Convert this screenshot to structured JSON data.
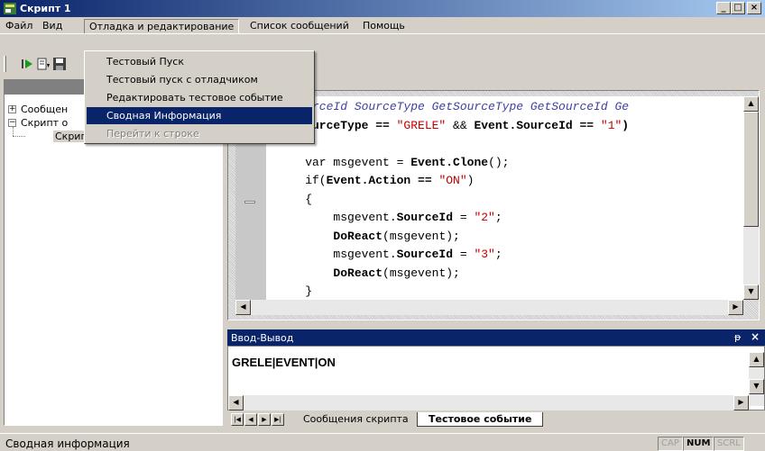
{
  "window": {
    "title": "Скрипт 1",
    "buttons": {
      "minimize": "_",
      "maximize": "□",
      "close": "×"
    }
  },
  "menubar": {
    "items": [
      "Файл",
      "Вид",
      "Отладка и редактирование",
      "Список сообщений",
      "Помощь"
    ],
    "open_index": 2
  },
  "debug_menu": {
    "items": [
      {
        "label": "Тестовый Пуск",
        "state": "normal"
      },
      {
        "label": "Тестовый пуск с отладчиком",
        "state": "normal"
      },
      {
        "label": "Редактировать тестовое событие",
        "state": "normal"
      },
      {
        "label": "Сводная Информация",
        "state": "highlighted"
      },
      {
        "label": "Перейти к строке",
        "state": "disabled"
      }
    ]
  },
  "tree": {
    "items": [
      {
        "label": "Сообщен",
        "expander": "+"
      },
      {
        "label": "Скрипт о",
        "expander": "−"
      },
      {
        "label": "Скрип",
        "expander": ""
      }
    ]
  },
  "editor": {
    "lines": [
      {
        "segments": [
          {
            "t": "n SourceId SourceType GetSourceType GetSourceId Ge",
            "c": "cmt"
          }
        ]
      },
      {
        "segments": [
          {
            "t": "nt.SourceType == ",
            "c": "kw"
          },
          {
            "t": "\"GRELE\"",
            "c": "str"
          },
          {
            "t": " && ",
            "c": ""
          },
          {
            "t": "Event.SourceId == ",
            "c": "kw"
          },
          {
            "t": "\"1\"",
            "c": "str"
          },
          {
            "t": ")",
            "c": "kw"
          }
        ]
      },
      {
        "segments": [
          {
            "t": "",
            "c": ""
          }
        ]
      },
      {
        "segments": [
          {
            "t": "    var msgevent = ",
            "c": ""
          },
          {
            "t": "Event.Clone",
            "c": "kw"
          },
          {
            "t": "();",
            "c": ""
          }
        ]
      },
      {
        "segments": [
          {
            "t": "    if(",
            "c": ""
          },
          {
            "t": "Event.Action == ",
            "c": "kw"
          },
          {
            "t": "\"ON\"",
            "c": "str"
          },
          {
            "t": ")",
            "c": ""
          }
        ]
      },
      {
        "segments": [
          {
            "t": "    {",
            "c": ""
          }
        ]
      },
      {
        "segments": [
          {
            "t": "        msgevent.",
            "c": ""
          },
          {
            "t": "SourceId",
            "c": "kw"
          },
          {
            "t": " = ",
            "c": ""
          },
          {
            "t": "\"2\"",
            "c": "str"
          },
          {
            "t": ";",
            "c": ""
          }
        ]
      },
      {
        "segments": [
          {
            "t": "        ",
            "c": ""
          },
          {
            "t": "DoReact",
            "c": "kw"
          },
          {
            "t": "(msgevent);",
            "c": ""
          }
        ]
      },
      {
        "segments": [
          {
            "t": "        msgevent.",
            "c": ""
          },
          {
            "t": "SourceId",
            "c": "kw"
          },
          {
            "t": " = ",
            "c": ""
          },
          {
            "t": "\"3\"",
            "c": "str"
          },
          {
            "t": ";",
            "c": ""
          }
        ]
      },
      {
        "segments": [
          {
            "t": "        ",
            "c": ""
          },
          {
            "t": "DoReact",
            "c": "kw"
          },
          {
            "t": "(msgevent);",
            "c": ""
          }
        ]
      },
      {
        "segments": [
          {
            "t": "    }",
            "c": ""
          }
        ]
      }
    ]
  },
  "io_panel": {
    "title": "Ввод-Вывод",
    "pin": "ᵽ",
    "close": "×",
    "content": "GRELE|EVENT|ON",
    "tabs": [
      {
        "label": "Сообщения скрипта",
        "active": false
      },
      {
        "label": "Тестовое событие",
        "active": true
      }
    ]
  },
  "statusbar": {
    "text": "Сводная информация",
    "indicators": [
      {
        "label": "CAP",
        "on": false
      },
      {
        "label": "NUM",
        "on": true
      },
      {
        "label": "SCRL",
        "on": false
      }
    ]
  }
}
